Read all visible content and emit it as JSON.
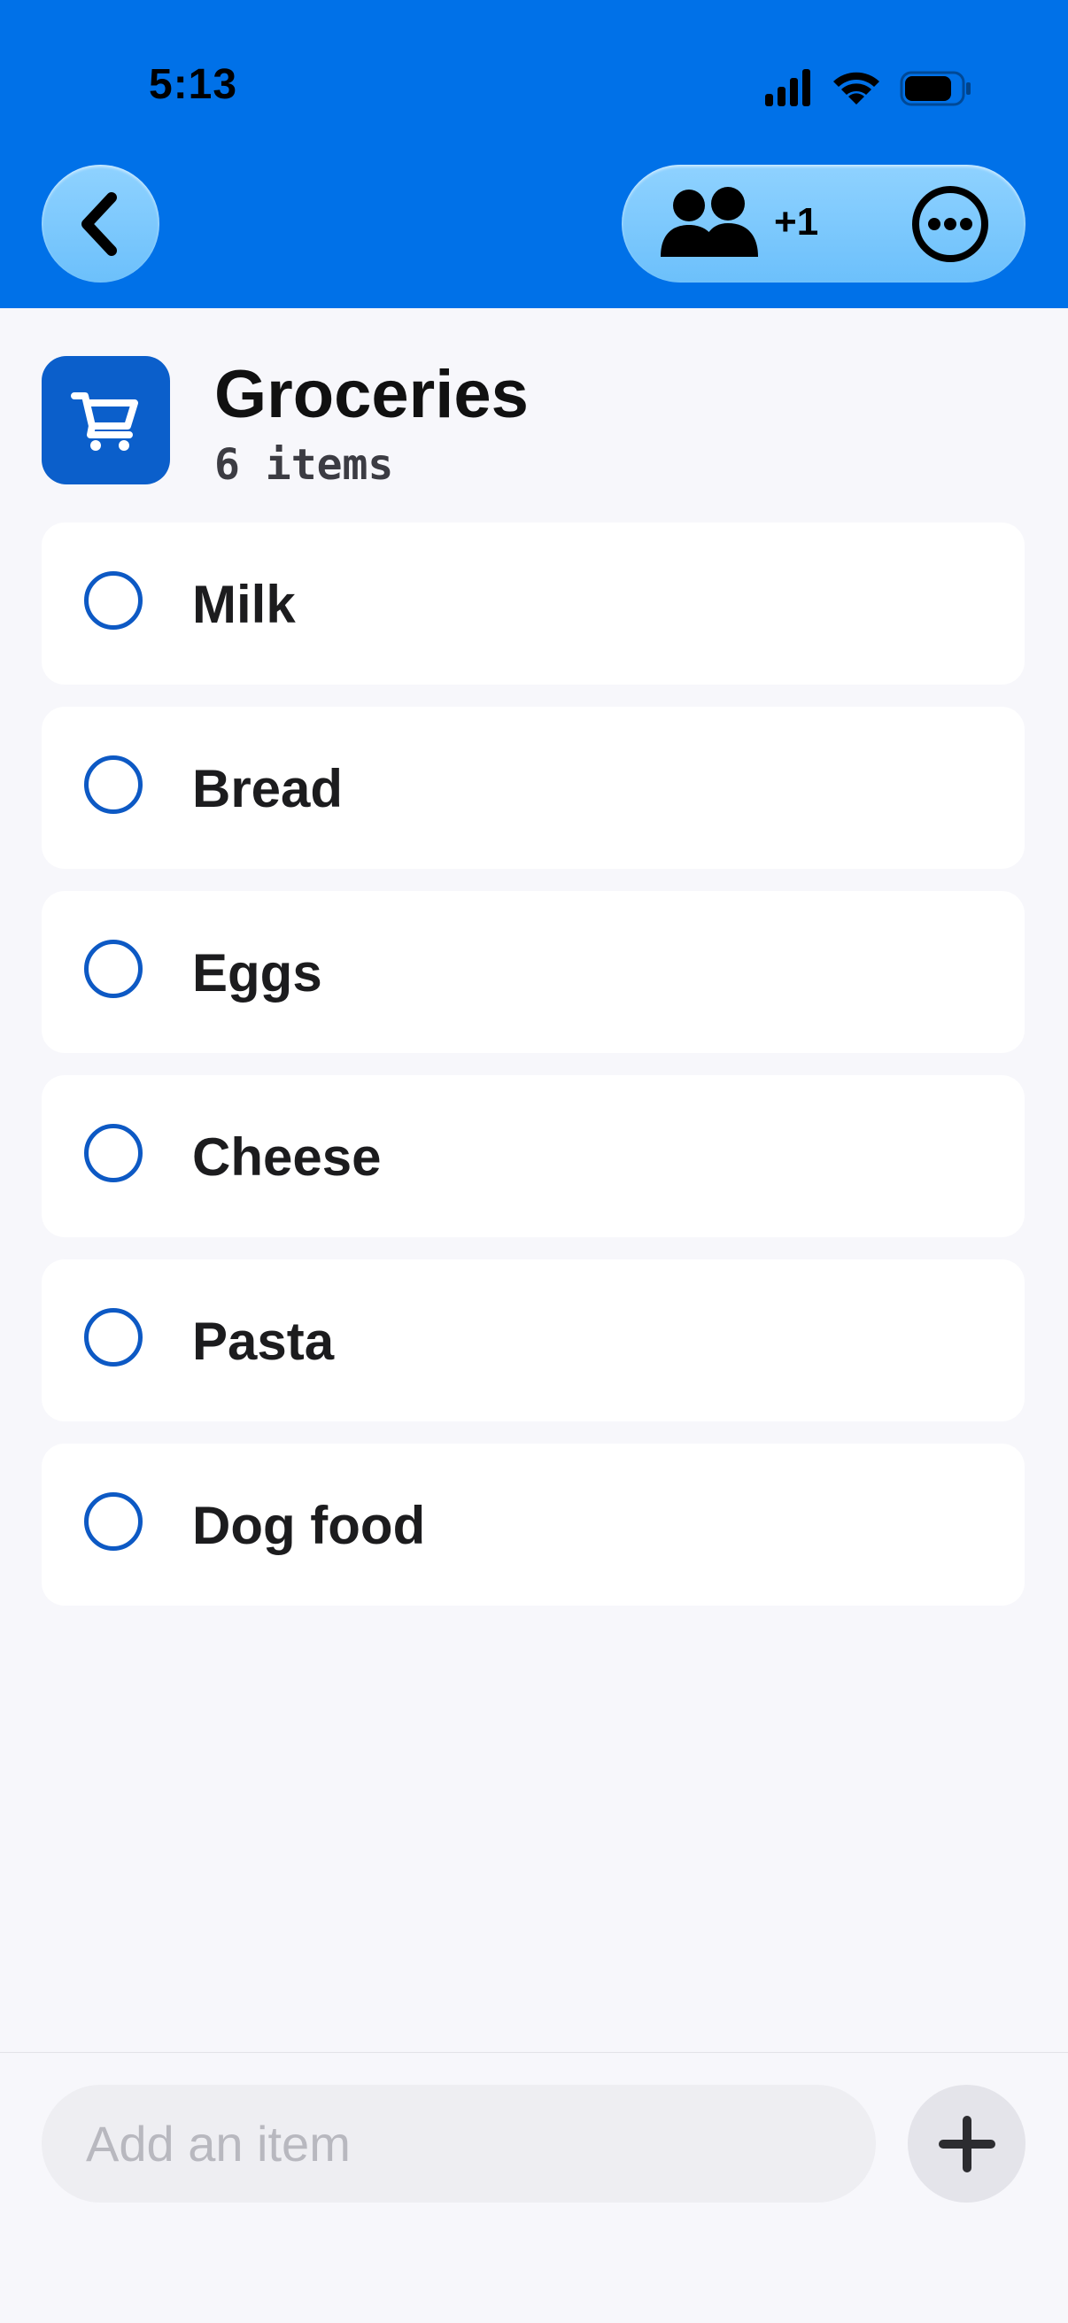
{
  "status_bar": {
    "time": "5:13",
    "icons": [
      "cellular-signal-icon",
      "wifi-icon",
      "battery-icon"
    ]
  },
  "nav": {
    "back_icon": "chevron-left-icon",
    "share_icon": "people-icon",
    "share_count": "+1",
    "more_icon": "ellipsis-circle-icon"
  },
  "list": {
    "icon": "cart-icon",
    "title": "Groceries",
    "count": "6 items",
    "items": [
      {
        "label": "Milk",
        "checked": false
      },
      {
        "label": "Bread",
        "checked": false
      },
      {
        "label": "Eggs",
        "checked": false
      },
      {
        "label": "Cheese",
        "checked": false
      },
      {
        "label": "Pasta",
        "checked": false
      },
      {
        "label": "Dog food",
        "checked": false
      }
    ]
  },
  "composer": {
    "placeholder": "Add an item",
    "value": "",
    "add_icon": "plus-icon"
  },
  "colors": {
    "header_blue": "#0071e8",
    "pill_blue": "#7ccaff",
    "list_icon_blue": "#0b5fcb",
    "checkbox_blue": "#0d59c4",
    "background": "#f7f7fb"
  }
}
